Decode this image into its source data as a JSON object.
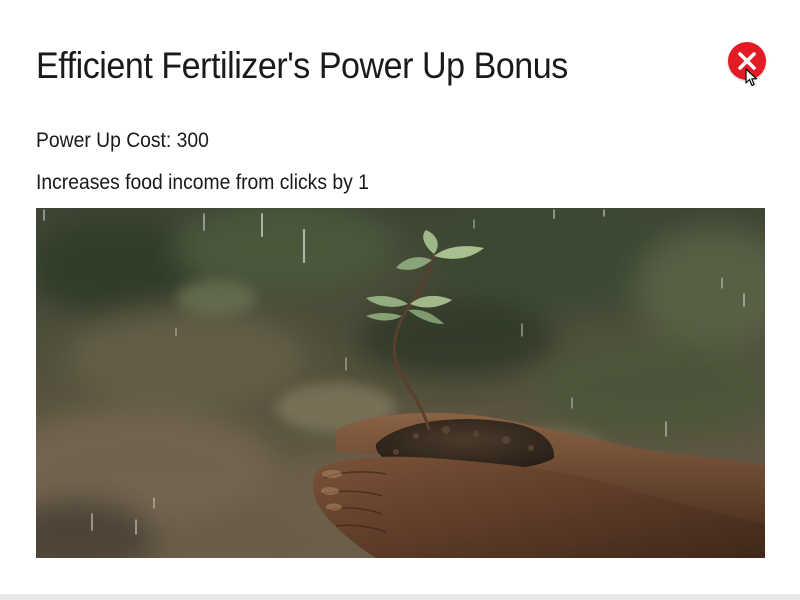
{
  "dialog": {
    "title": "Efficient Fertilizer's Power Up Bonus",
    "cost_text": "Power Up Cost: 300",
    "description": "Increases food income from clicks by 1",
    "close_icon": "close-icon"
  },
  "image": {
    "subject": "seedling-in-hands-photo"
  },
  "colors": {
    "close_button": "#e21b24",
    "title_text": "#1a1a1a",
    "background": "#ffffff"
  }
}
